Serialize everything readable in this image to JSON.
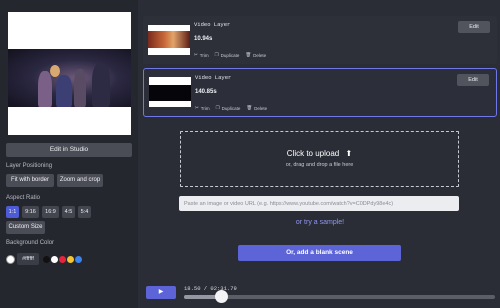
{
  "left": {
    "edit_in_studio": "Edit in Studio",
    "layer_positioning": {
      "title": "Layer Positioning",
      "fit_with_border": "Fit with border",
      "zoom_and_crop": "Zoom and crop"
    },
    "aspect_ratio": {
      "title": "Aspect Ratio",
      "options": [
        "1:1",
        "9:16",
        "16:9",
        "4:5",
        "5:4"
      ],
      "selected": "1:1",
      "custom_size": "Custom Size"
    },
    "background_color": {
      "title": "Background Color",
      "value": "#ffffff",
      "swatches": [
        "#111111",
        "#ffffff",
        "#e8243c",
        "#f4c531",
        "#3a84f0"
      ]
    }
  },
  "layers": [
    {
      "title": "Video Layer",
      "duration": "10.94s",
      "trim": "Trim",
      "duplicate": "Duplicate",
      "delete": "Delete",
      "edit": "Edit",
      "selected": false
    },
    {
      "title": "Video Layer",
      "duration": "140.85s",
      "trim": "Trim",
      "duplicate": "Duplicate",
      "delete": "Delete",
      "edit": "Edit",
      "selected": true
    }
  ],
  "upload": {
    "title": "Click to upload",
    "subtitle": "or, drag and drop a file here"
  },
  "url_input": {
    "value": "",
    "placeholder": "Paste an image or video URL (e.g. https://www.youtube.com/watch?v=C0DPdy98e4c)"
  },
  "try_sample": "or try a sample!",
  "blank_scene": "Or, add a blank scene",
  "player": {
    "time_display": "18.50 / 02:31.79",
    "progress": 0.122
  },
  "colors": {
    "accent": "#5d64d8",
    "selected_border": "#6f78e8",
    "link": "#8f97f2"
  }
}
